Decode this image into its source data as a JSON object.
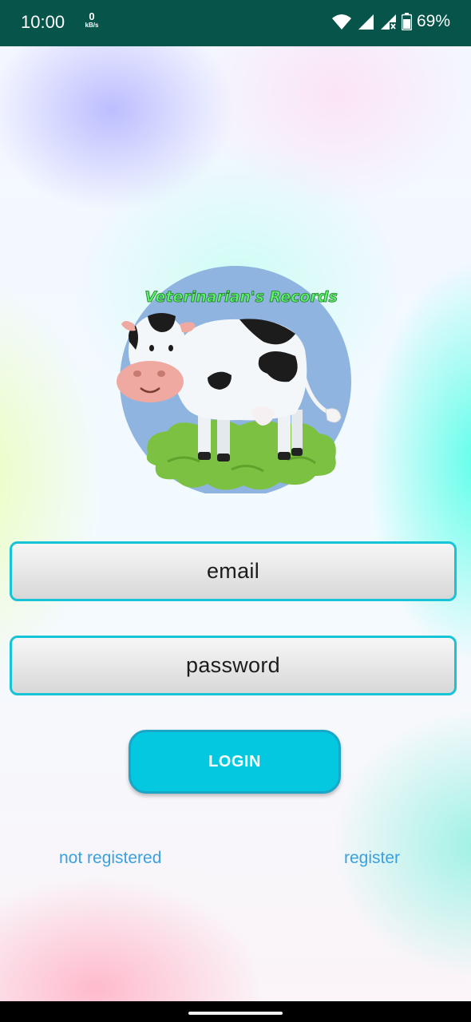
{
  "status_bar": {
    "time": "10:00",
    "net_speed_value": "0",
    "net_speed_unit": "kB/s",
    "battery_percent": "69%",
    "icons": [
      "wifi-icon",
      "signal-icon",
      "signal-no-data-icon",
      "battery-icon"
    ]
  },
  "logo": {
    "title": "Veterinarian's Records"
  },
  "form": {
    "email_placeholder": "email",
    "password_placeholder": "password",
    "login_label": "LOGIN"
  },
  "links": {
    "not_registered": "not registered",
    "register": "register"
  },
  "colors": {
    "status_bar": "#06544a",
    "field_border": "#17c3d7",
    "button": "#04c8df",
    "link": "#3aa0e0"
  }
}
